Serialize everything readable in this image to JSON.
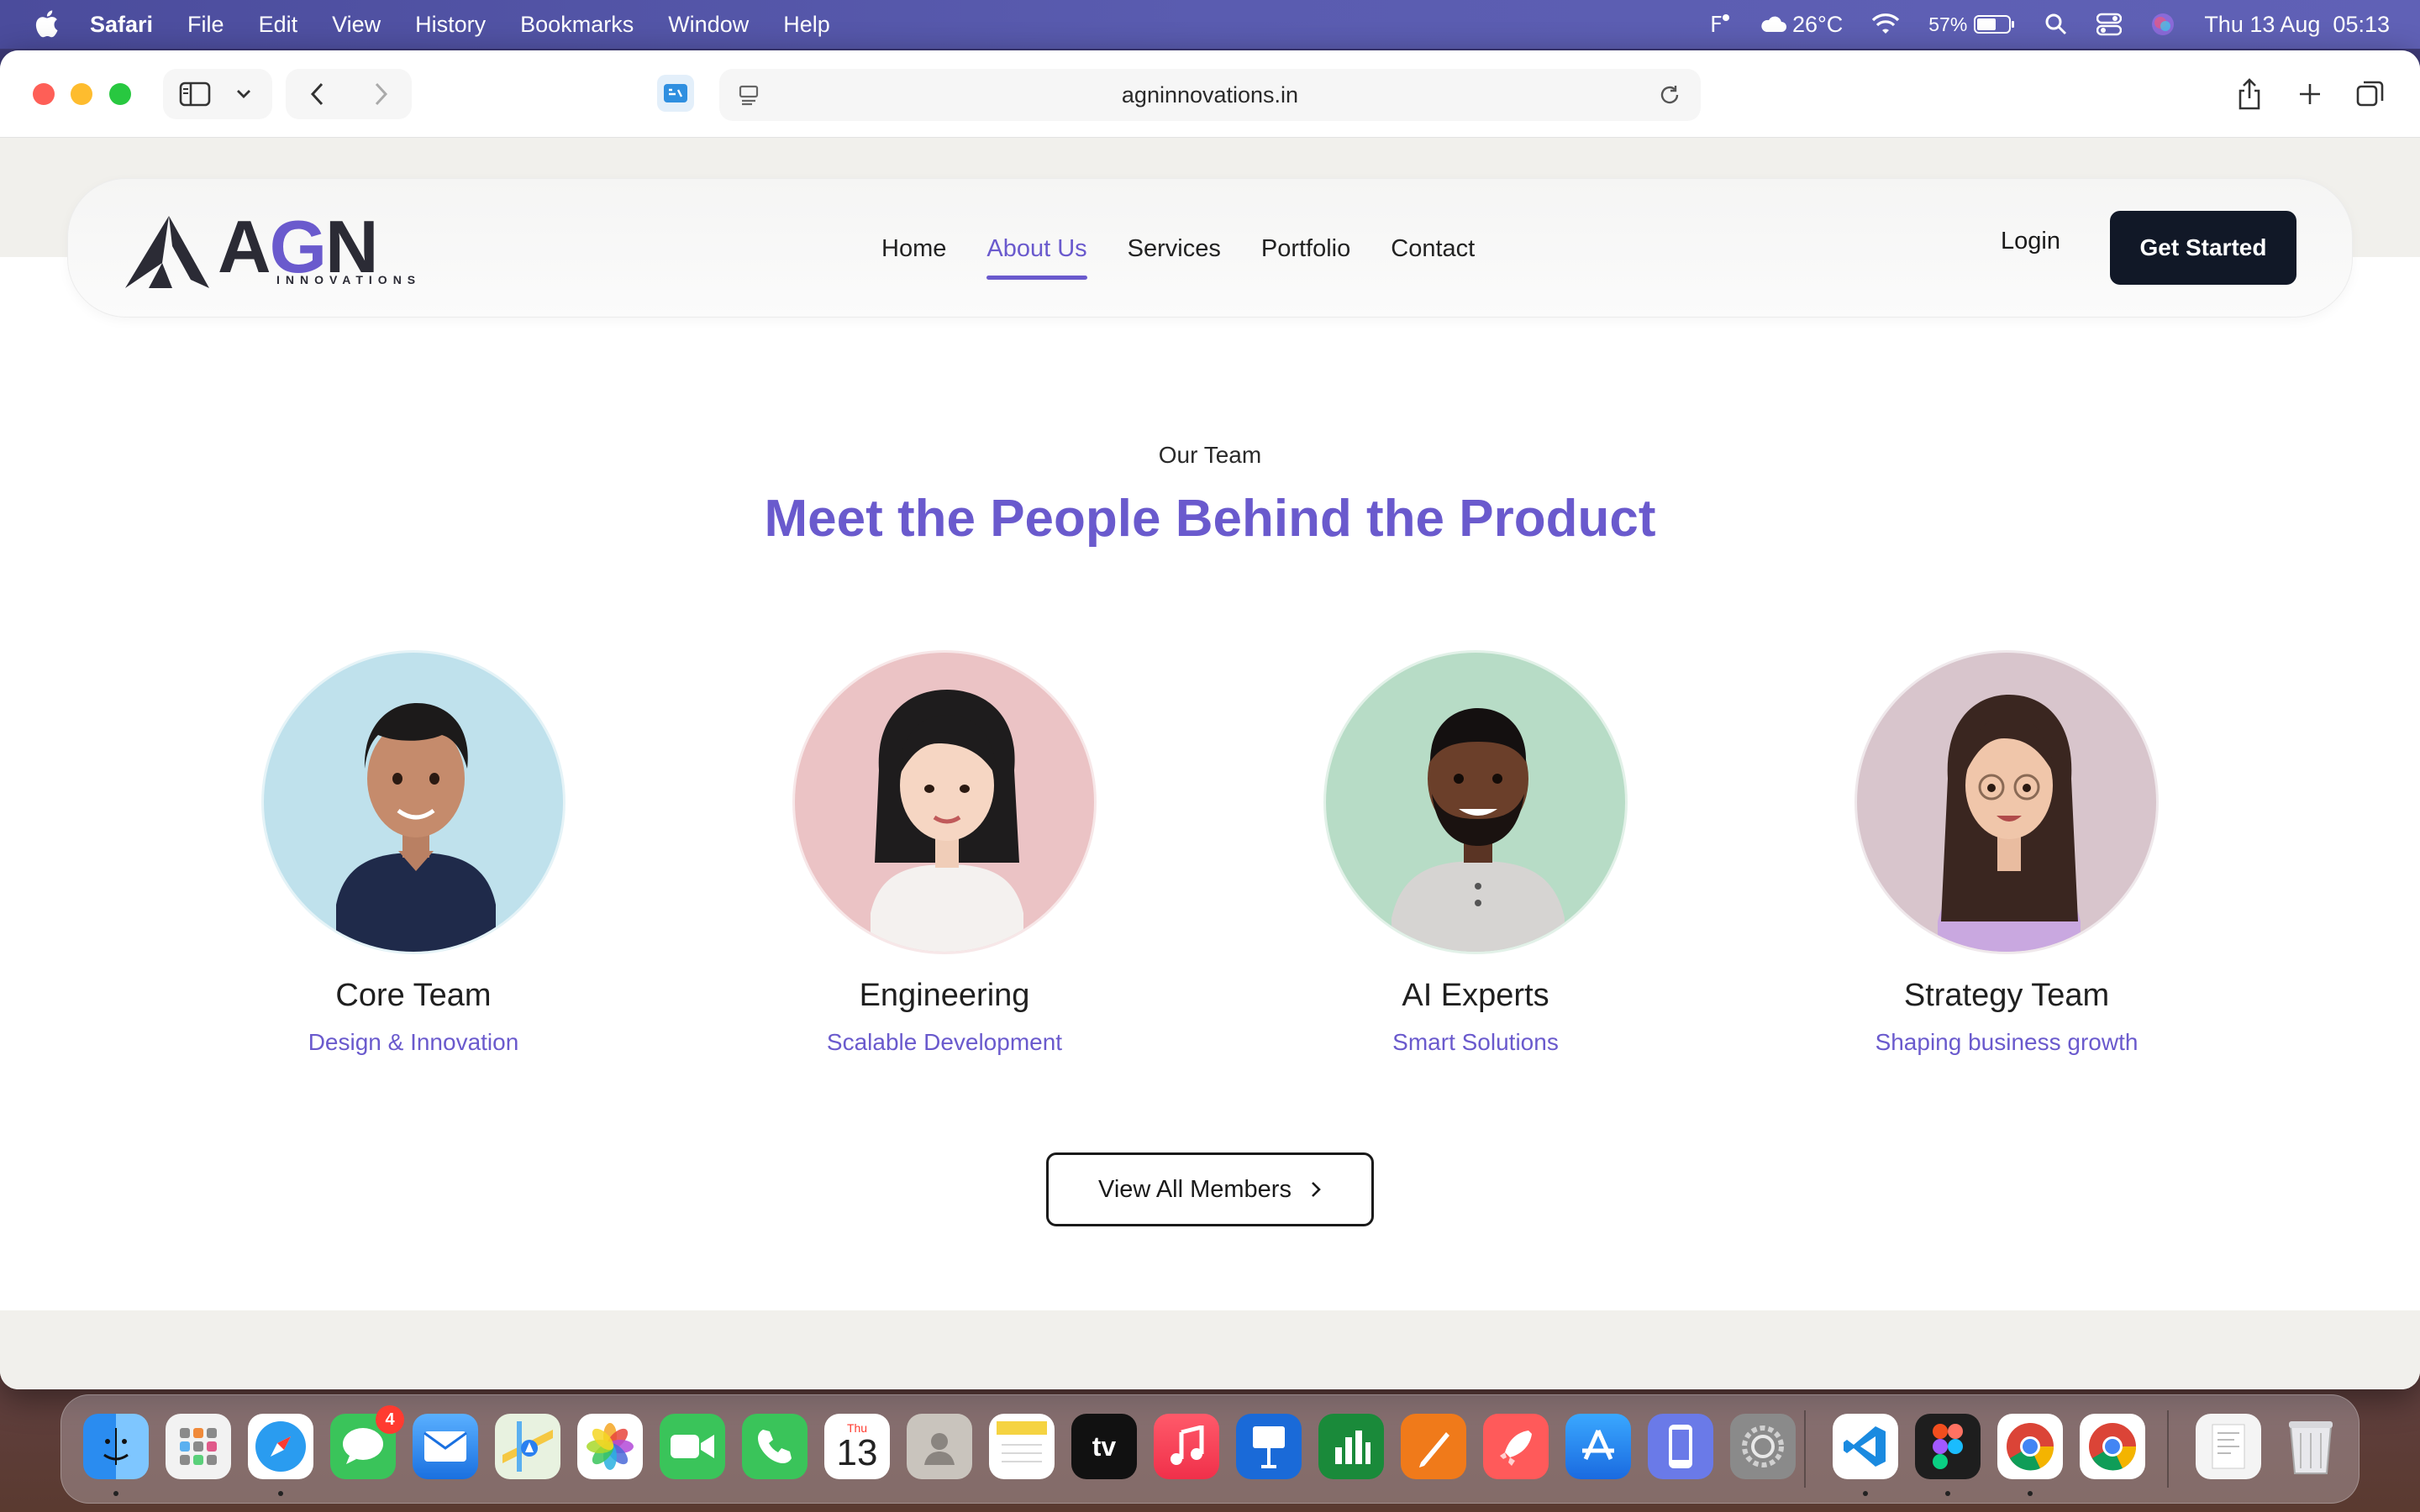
{
  "menubar": {
    "app_name": "Safari",
    "items": [
      "File",
      "Edit",
      "View",
      "History",
      "Bookmarks",
      "Window",
      "Help"
    ],
    "temperature": "26°C",
    "battery": "57%",
    "datetime": "Thu 13 Aug  05:13"
  },
  "browser": {
    "url": "agninnovations.in"
  },
  "site": {
    "logo_text_a": "A",
    "logo_text_g": "G",
    "logo_text_n": "N",
    "logo_sub": "INNOVATIONS",
    "nav": [
      "Home",
      "About Us",
      "Services",
      "Portfolio",
      "Contact"
    ],
    "active_nav": "About Us",
    "login_label": "Login",
    "cta_label": "Get Started"
  },
  "team_section": {
    "eyebrow": "Our Team",
    "headline": "Meet the People Behind the Product",
    "members": [
      {
        "name": "Core Team",
        "role": "Design & Innovation",
        "bg": "#bfe1ec"
      },
      {
        "name": "Engineering",
        "role": "Scalable Development",
        "bg": "#ebc3c5"
      },
      {
        "name": "AI Experts",
        "role": "Smart Solutions",
        "bg": "#b7dcc6"
      },
      {
        "name": "Strategy Team",
        "role": "Shaping business growth",
        "bg": "#d8c5cc"
      }
    ],
    "view_all_label": "View All Members"
  },
  "dock": {
    "messages_badge": "4",
    "calendar_day": "Thu",
    "calendar_date": "13",
    "tv_label": "tv"
  },
  "colors": {
    "accent": "#6a5acd",
    "cta_bg": "#111827"
  }
}
